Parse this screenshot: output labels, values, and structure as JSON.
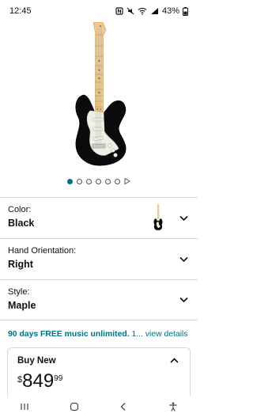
{
  "status_bar": {
    "time": "12:45",
    "battery_percent": "43%"
  },
  "gallery": {
    "dot_count": 6,
    "active_index": 0
  },
  "options": {
    "color": {
      "label": "Color:",
      "value": "Black"
    },
    "hand_orientation": {
      "label": "Hand Orientation:",
      "value": "Right"
    },
    "style": {
      "label": "Style:",
      "value": "Maple"
    }
  },
  "promo": {
    "bold_text": "90 days FREE music unlimited.",
    "trail_text": " 1...",
    "link_text": " view details"
  },
  "buy_new": {
    "title": "Buy New",
    "currency": "$",
    "price_whole": "849",
    "price_fraction": "99"
  },
  "icons": {
    "status": [
      "nfc-icon",
      "mute-icon",
      "wifi-icon",
      "signal-icon",
      "battery-icon"
    ],
    "nav": [
      "recent-apps-icon",
      "home-icon",
      "back-icon",
      "accessibility-icon"
    ]
  },
  "colors": {
    "link": "#007185",
    "border": "#d5d9d9",
    "text": "#0f1111"
  }
}
